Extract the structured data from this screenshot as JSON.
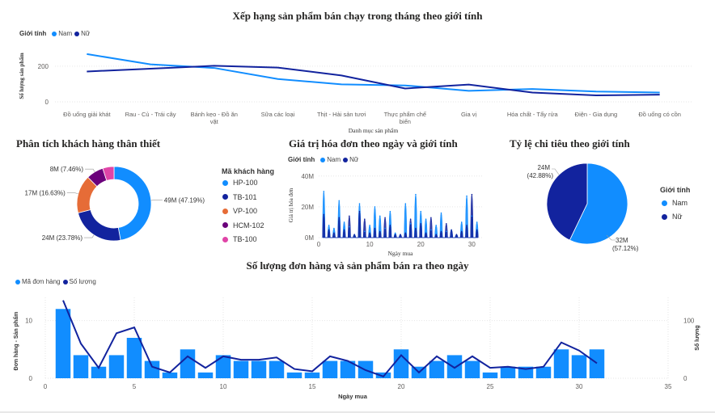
{
  "colors": {
    "nam": "#118DFF",
    "nu": "#12239E",
    "hp100": "#118DFF",
    "tb101": "#12239E",
    "vp100": "#E66C37",
    "hcm102": "#6B007B",
    "tb100": "#E044A7",
    "grid": "#e6e6e6",
    "axis_text": "#605e5c"
  },
  "chart_data": [
    {
      "id": "rank",
      "type": "line",
      "title": "Xếp hạng sản phẩm bán chạy trong tháng theo giới tính",
      "legend_title": "Giới tính",
      "xlabel": "Danh mục sản phẩm",
      "ylabel": "Số lượng sản phẩm",
      "categories": [
        "Đồ uống giải khát",
        "Rau - Củ - Trái cây",
        "Bánh kẹo - Đồ ăn vặt",
        "Sữa các loại",
        "Thịt - Hải sản tươi",
        "Thực phẩm chế biến",
        "Gia vị",
        "Hóa chất - Tẩy rửa",
        "Điện - Gia dụng",
        "Đồ uống có cồn"
      ],
      "category_lines": [
        [
          "Đồ uống giải khát"
        ],
        [
          "Rau - Củ - Trái cây"
        ],
        [
          "Bánh kẹo - Đồ ăn",
          "vặt"
        ],
        [
          "Sữa các loại"
        ],
        [
          "Thịt - Hải sản tươi"
        ],
        [
          "Thực phẩm chế",
          "biến"
        ],
        [
          "Gia vị"
        ],
        [
          "Hóa chất - Tẩy rửa"
        ],
        [
          "Điện - Gia dụng"
        ],
        [
          "Đồ uống có cồn"
        ]
      ],
      "yticks": [
        0,
        200
      ],
      "ylim": [
        0,
        290
      ],
      "series": [
        {
          "name": "Nam",
          "values": [
            268,
            210,
            190,
            128,
            98,
            92,
            62,
            72,
            58,
            52
          ]
        },
        {
          "name": "Nữ",
          "values": [
            170,
            186,
            202,
            192,
            148,
            75,
            97,
            52,
            36,
            40
          ]
        }
      ]
    },
    {
      "id": "donut",
      "type": "pie",
      "title": "Phân tích khách hàng thân thiết",
      "legend_title": "Mã khách hàng",
      "slices": [
        {
          "name": "HP-100",
          "value": 47.19,
          "label": "49M (47.19%)"
        },
        {
          "name": "TB-101",
          "value": 23.78,
          "label": "24M (23.78%)"
        },
        {
          "name": "VP-100",
          "value": 16.63,
          "label": "17M (16.63%)"
        },
        {
          "name": "HCM-102",
          "value": 7.46,
          "label": "8M (7.46%)"
        },
        {
          "name": "TB-100",
          "value": 4.94,
          "label": ""
        }
      ]
    },
    {
      "id": "invoice",
      "type": "area",
      "title": "Giá trị hóa đơn theo ngày và giới tính",
      "legend_title": "Giới tính",
      "xlabel": "Ngày mua",
      "ylabel": "Giá trị hóa đơn",
      "xlim": [
        0,
        32
      ],
      "ylim": [
        0,
        42
      ],
      "xticks": [
        0,
        10,
        20,
        30
      ],
      "yticks": [
        0,
        20,
        40
      ],
      "ytick_labels": [
        "0M",
        "20M",
        "40M"
      ],
      "series": [
        {
          "name": "Nam",
          "values": [
            30,
            8,
            6,
            24,
            10,
            7,
            2,
            22,
            4,
            8,
            20,
            14,
            6,
            17,
            3,
            2,
            22,
            9,
            28,
            17,
            12,
            5,
            8,
            16,
            4,
            5,
            2,
            10,
            27,
            14,
            10
          ]
        },
        {
          "name": "Nữ",
          "values": [
            15,
            5,
            3,
            13,
            5,
            14,
            2,
            17,
            12,
            3,
            6,
            4,
            13,
            8,
            2,
            2,
            3,
            12,
            6,
            9,
            3,
            13,
            2,
            4,
            9,
            5,
            2,
            4,
            8,
            28,
            5
          ]
        }
      ]
    },
    {
      "id": "gender_pie",
      "type": "pie",
      "title": "Tỷ lệ chi tiêu theo giới tính",
      "legend_title": "Giới tính",
      "slices": [
        {
          "name": "Nam",
          "value": 57.12,
          "label_value": "32M",
          "label_pct": "(57.12%)"
        },
        {
          "name": "Nữ",
          "value": 42.88,
          "label_value": "24M",
          "label_pct": "(42.88%)"
        }
      ]
    },
    {
      "id": "orders",
      "type": "bar",
      "title": "Số lượng đơn hàng và sản phẩm bán ra theo ngày",
      "xlabel": "Ngày mua",
      "ylabel_left": "Đơn hàng - Sản phẩm",
      "ylabel_right": "Số lượng",
      "xlim": [
        0,
        35
      ],
      "xticks": [
        0,
        5,
        10,
        15,
        20,
        25,
        30,
        35
      ],
      "ylim_left": [
        0,
        14
      ],
      "yticks_left": [
        0,
        10
      ],
      "ylim_right": [
        0,
        140
      ],
      "yticks_right": [
        0,
        100
      ],
      "series": [
        {
          "name": "Mã đơn hàng",
          "axis": "left",
          "x": [
            1,
            2,
            3,
            4,
            5,
            6,
            7,
            8,
            9,
            10,
            11,
            12,
            13,
            14,
            15,
            16,
            17,
            18,
            19,
            20,
            21,
            22,
            23,
            24,
            25,
            26,
            27,
            28,
            29,
            30,
            31
          ],
          "values": [
            12,
            4,
            2,
            4,
            7,
            3,
            1,
            5,
            1,
            4,
            3,
            3,
            3,
            1,
            1,
            3,
            3,
            3,
            1,
            5,
            2,
            3,
            4,
            3,
            1,
            2,
            2,
            2,
            5,
            4,
            5
          ]
        },
        {
          "name": "Số lượng",
          "axis": "right",
          "x": [
            1,
            2,
            3,
            4,
            5,
            6,
            7,
            8,
            9,
            10,
            11,
            12,
            13,
            14,
            15,
            16,
            17,
            18,
            19,
            20,
            21,
            22,
            23,
            24,
            25,
            26,
            27,
            28,
            29,
            30,
            31
          ],
          "values": [
            135,
            60,
            18,
            78,
            88,
            20,
            10,
            38,
            18,
            38,
            32,
            32,
            36,
            16,
            12,
            38,
            30,
            14,
            3,
            40,
            10,
            38,
            18,
            38,
            18,
            20,
            16,
            20,
            62,
            48,
            26
          ]
        }
      ]
    }
  ]
}
